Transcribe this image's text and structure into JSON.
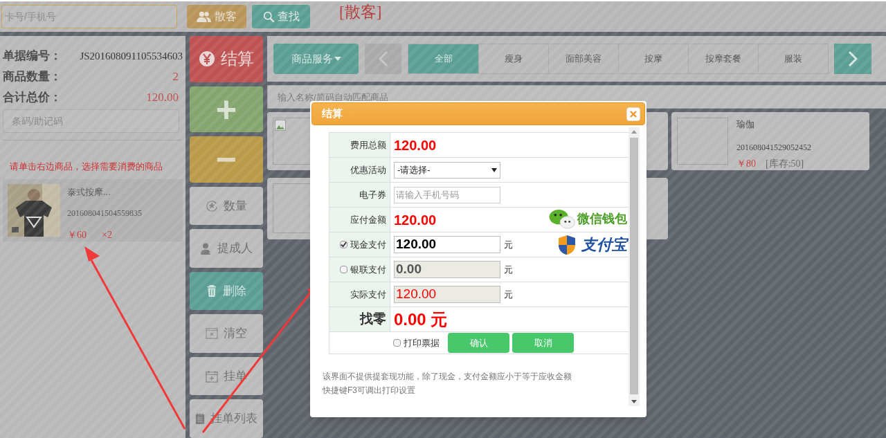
{
  "top_bar": {
    "member_field": {
      "placeholder": "卡号/手机号"
    },
    "walkin_button": "散客",
    "search_button": "查找",
    "customer_label": "[散客]"
  },
  "order": {
    "fields": [
      {
        "label": "单据编号：",
        "value": "JS201608091105534603"
      },
      {
        "label": "商品数量：",
        "value": "2"
      },
      {
        "label": "合计总价：",
        "value": "120.00"
      }
    ],
    "barcode_field": {
      "placeholder": "条码/助记码"
    },
    "hint": "请单击右边商品，选择需要消费的商品",
    "items": [
      {
        "kind": "picture",
        "name": "泰式按摩...",
        "code": "201608041504559835",
        "price": "￥60",
        "quantity": "×2"
      }
    ]
  },
  "actions": [
    {
      "kind": "checkout",
      "label": "结算"
    },
    {
      "kind": "plus",
      "label": "+"
    },
    {
      "kind": "minus",
      "label": "−"
    },
    {
      "kind": "plain",
      "label": "数量"
    },
    {
      "kind": "plain",
      "label": "提成人"
    },
    {
      "kind": "accent",
      "label": "删除"
    },
    {
      "kind": "plain",
      "label": "清空"
    },
    {
      "kind": "plain",
      "label": "挂单"
    },
    {
      "kind": "plain",
      "label": "挂单列表"
    }
  ],
  "catalog": {
    "menu_button": "商品服务",
    "tabs": [
      {
        "label": "全部",
        "selected": true
      },
      {
        "label": "瘦身",
        "selected": false
      },
      {
        "label": "面部美容",
        "selected": false
      },
      {
        "label": "按摩",
        "selected": false
      },
      {
        "label": "按摩套餐",
        "selected": false
      },
      {
        "label": "服装",
        "selected": false
      }
    ],
    "search_field": {
      "placeholder": "输入名称/简码自动匹配商品"
    },
    "products": [
      {
        "kind": "broken"
      },
      {
        "kind": "full",
        "name": "瑜伽",
        "code": "201608041529052452",
        "price": "￥80",
        "stock": "[库存:50]"
      },
      {
        "kind": "empty"
      }
    ]
  },
  "dialog": {
    "title": "结算",
    "rows": [
      {
        "kind": "amount",
        "label": "费用总额",
        "value": "120.00"
      },
      {
        "kind": "select",
        "label": "优惠活动",
        "value": "-请选择-"
      },
      {
        "kind": "input",
        "label": "电子券",
        "placeholder": "请输入手机号码"
      },
      {
        "kind": "amount",
        "label": "应付金额",
        "value": "120.00",
        "logo": {
          "kind": "wechat",
          "text": "微信钱包"
        }
      },
      {
        "kind": "pay",
        "label": "现金支付",
        "checked": true,
        "value": "120.00",
        "unit": "元",
        "logo": {
          "kind": "alipay",
          "text": "支付宝"
        }
      },
      {
        "kind": "pay",
        "label": "银联支付",
        "checked": false,
        "value": "0.00",
        "unit": "元"
      },
      {
        "kind": "readonly",
        "label": "实际支付",
        "value": "120.00",
        "unit": "元"
      },
      {
        "kind": "change",
        "label": "找零",
        "value": "0.00 元"
      }
    ],
    "print": {
      "label": "打印票据",
      "checked": false
    },
    "buttons": [
      "确认",
      "取消"
    ],
    "notes": [
      "该界面不提供提套现功能，除了现金，支付金额应小于等于应收金额",
      "快捷键F3可调出打印设置"
    ]
  }
}
